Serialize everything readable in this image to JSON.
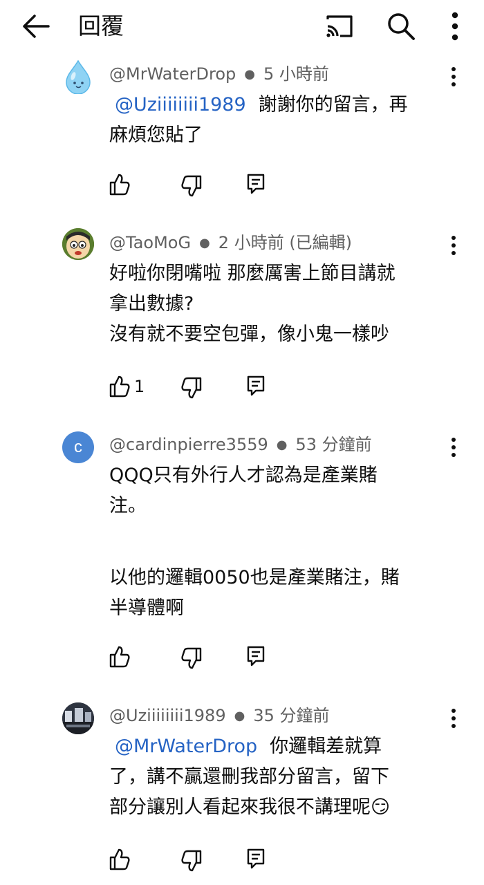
{
  "app_bar": {
    "title": "回覆",
    "icons": [
      "back-arrow-icon",
      "cast-icon",
      "search-icon",
      "more-vert-icon"
    ]
  },
  "comments": [
    {
      "author": "@MrWaterDrop",
      "time": "5 小時前",
      "avatar": "water-drop-avatar",
      "mention": "@Uziiiiiiii1989",
      "lines": [
        "謝謝你的留言，再",
        "麻煩您貼了"
      ],
      "likes": ""
    },
    {
      "author": "@TaoMoG",
      "time": "2 小時前 (已編輯)",
      "avatar": "cartoon-face-avatar",
      "mention": "",
      "lines": [
        "好啦你閉嘴啦 那麼厲害上節目講就",
        "拿出數據?",
        "沒有就不要空包彈，像小鬼一樣吵"
      ],
      "likes": "1"
    },
    {
      "author": "@cardinpierre3559",
      "time": "53 分鐘前",
      "avatar": "letter-avatar",
      "avatar_letter": "c",
      "avatar_color": "#4a86d4",
      "mention": "",
      "lines": [
        "QQQ只有外行人才認為是產業賭",
        "注。",
        "",
        "以他的邏輯0050也是產業賭注，賭",
        "半導體啊"
      ],
      "likes": ""
    },
    {
      "author": "@Uziiiiiiii1989",
      "time": "35 分鐘前",
      "avatar": "photo-avatar",
      "mention": "@MrWaterDrop",
      "lines": [
        "你邏輯差就算",
        "了，講不贏還刪我部分留言，留下",
        "部分讓別人看起來我很不講理呢😏"
      ],
      "likes": ""
    }
  ],
  "colors": {
    "mention": "#2563c4",
    "meta": "#606060",
    "text": "#0f0f0f"
  }
}
